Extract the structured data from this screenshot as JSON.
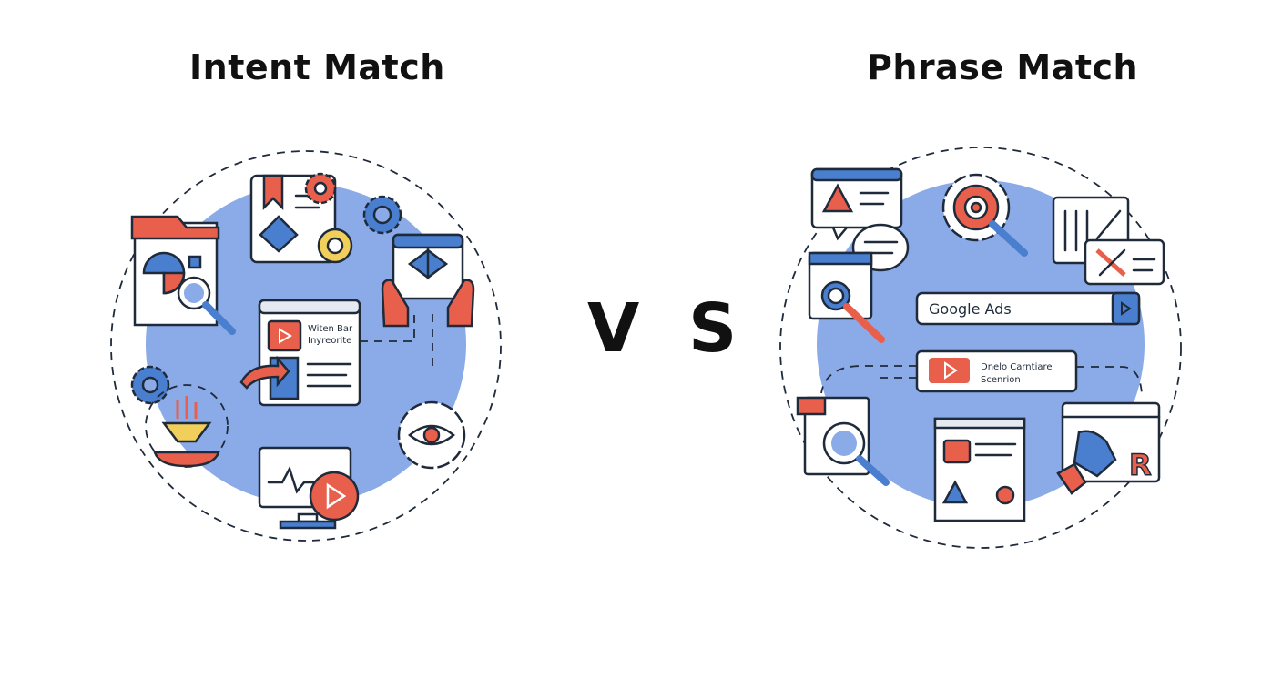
{
  "left": {
    "title": "Intent Match",
    "card_text_line1": "Witen Bar",
    "card_text_line2": "Inyreorite"
  },
  "vs": "V S",
  "right": {
    "title": "Phrase Match",
    "search_value": "Google Ads",
    "card_text_line1": "Dnelo Carntiare",
    "card_text_line2": "Scenrion"
  },
  "colors": {
    "circle": "#8aaae8",
    "accent_red": "#e8604c",
    "accent_blue": "#4a7fd0",
    "accent_yellow": "#f2cf5b",
    "outline": "#1f2a3a"
  }
}
